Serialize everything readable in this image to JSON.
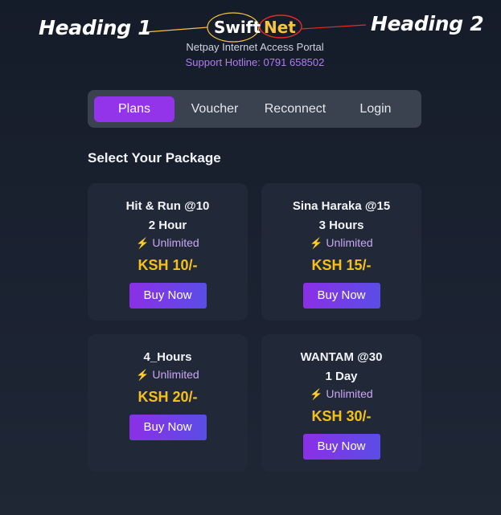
{
  "annotations": {
    "left_label": "Heading 1",
    "right_label": "Heading 2",
    "line_color": "#f5c542",
    "circle_color": "#e62a2a"
  },
  "brand": {
    "part1": "Swift",
    "part2": "Net",
    "subtitle": "Netpay Internet Access Portal",
    "hotline": "Support Hotline: 0791 658502"
  },
  "tabs": [
    {
      "label": "Plans",
      "active": true
    },
    {
      "label": "Voucher",
      "active": false
    },
    {
      "label": "Reconnect",
      "active": false
    },
    {
      "label": "Login",
      "active": false
    }
  ],
  "section_title": "Select Your Package",
  "packages": [
    {
      "name": "Hit & Run @10",
      "duration": "2 Hour",
      "bolt": "⚡",
      "data": "Unlimited",
      "price": "KSH 10/-",
      "button": "Buy Now"
    },
    {
      "name": "Sina Haraka @15",
      "duration": "3 Hours",
      "bolt": "⚡",
      "data": "Unlimited",
      "price": "KSH 15/-",
      "button": "Buy Now"
    },
    {
      "name": "4_Hours",
      "duration": "",
      "bolt": "⚡",
      "data": "Unlimited",
      "price": "KSH 20/-",
      "button": "Buy Now"
    },
    {
      "name": "WANTAM @30",
      "duration": "1 Day",
      "bolt": "⚡",
      "data": "Unlimited",
      "price": "KSH 30/-",
      "button": "Buy Now"
    }
  ],
  "colors": {
    "accent_purple": "#9333ea",
    "price_yellow": "#f5c118",
    "brand_yellow": "#f5c542"
  }
}
